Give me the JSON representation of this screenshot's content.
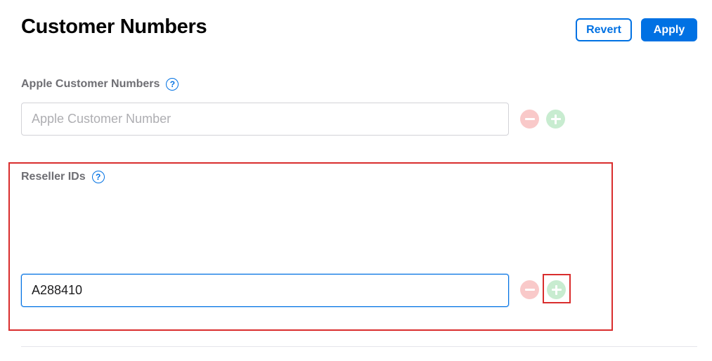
{
  "header": {
    "title": "Customer Numbers",
    "revert_label": "Revert",
    "apply_label": "Apply"
  },
  "apple_customer_numbers": {
    "label": "Apple Customer Numbers",
    "help_glyph": "?",
    "input_value": "",
    "input_placeholder": "Apple Customer Number"
  },
  "reseller_ids": {
    "label": "Reseller IDs",
    "help_glyph": "?",
    "input_value": "A288410",
    "input_placeholder": ""
  },
  "icons": {
    "help": "question-circle-icon",
    "remove": "minus-circle-icon",
    "add": "plus-circle-icon"
  },
  "colors": {
    "accent": "#0071e3",
    "remove": "#f9c9c9",
    "add": "#c8ecd0",
    "highlight": "#d92d2d"
  }
}
